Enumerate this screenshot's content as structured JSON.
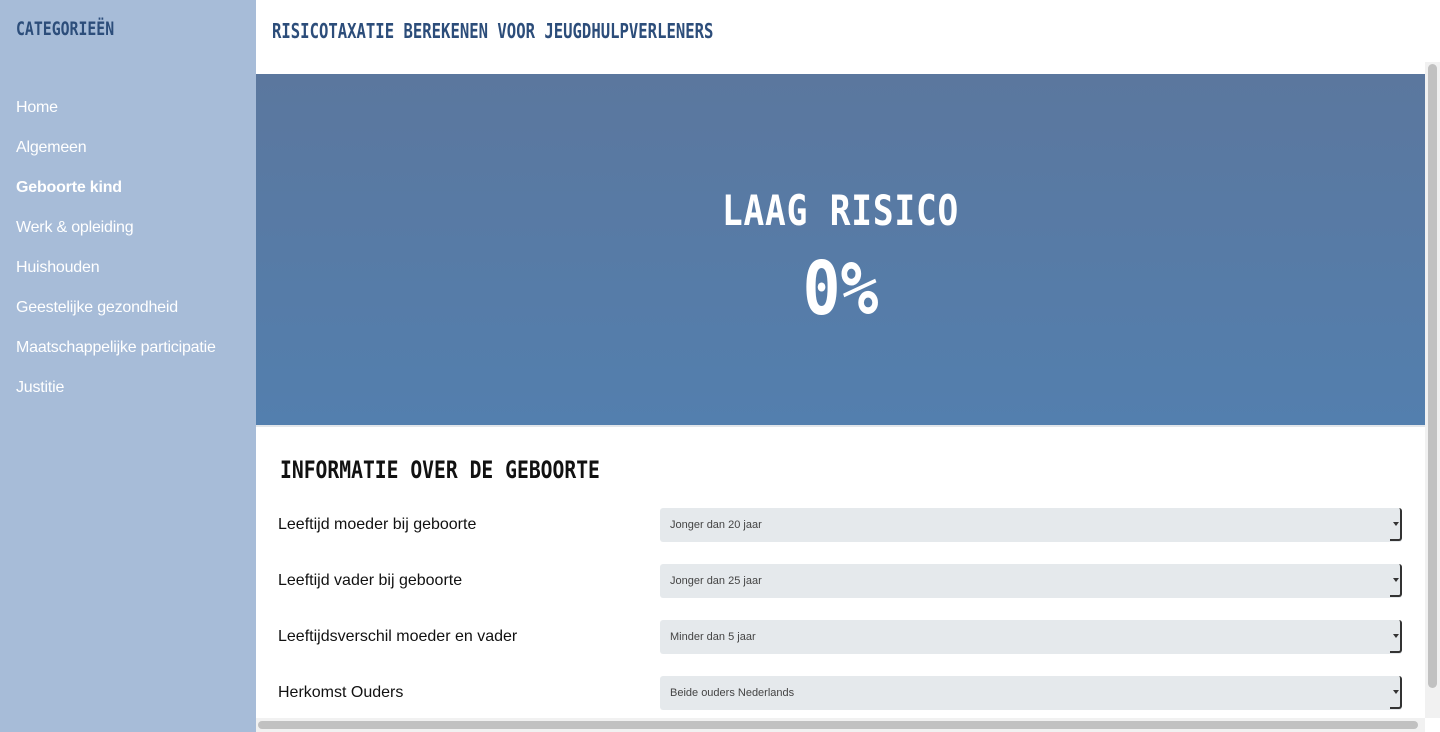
{
  "sidebar": {
    "title": "CATEGORIEËN",
    "items": [
      {
        "label": "Home"
      },
      {
        "label": "Algemeen"
      },
      {
        "label": "Geboorte kind"
      },
      {
        "label": "Werk & opleiding"
      },
      {
        "label": "Huishouden"
      },
      {
        "label": "Geestelijke gezondheid"
      },
      {
        "label": "Maatschappelijke participatie"
      },
      {
        "label": "Justitie"
      }
    ],
    "active_index": 2
  },
  "header": {
    "title": "RISICOTAXATIE BEREKENEN VOOR JEUGDHULPVERLENERS"
  },
  "result": {
    "label": "LAAG RISICO",
    "value": "0%"
  },
  "section": {
    "title": "INFORMATIE OVER DE GEBOORTE",
    "fields": [
      {
        "label": "Leeftijd moeder bij geboorte",
        "value": "Jonger dan 20 jaar"
      },
      {
        "label": "Leeftijd vader bij geboorte",
        "value": "Jonger dan 25 jaar"
      },
      {
        "label": "Leeftijdsverschil moeder en vader",
        "value": "Minder dan 5 jaar"
      },
      {
        "label": "Herkomst Ouders",
        "value": "Beide ouders Nederlands"
      }
    ]
  },
  "colors": {
    "sidebar_bg": "#a7bcd8",
    "accent": "#2c4d7a",
    "hero_top": "#5b779e",
    "hero_bottom": "#537fae"
  },
  "icons": {
    "select_arrow": "chevron-down-icon"
  }
}
